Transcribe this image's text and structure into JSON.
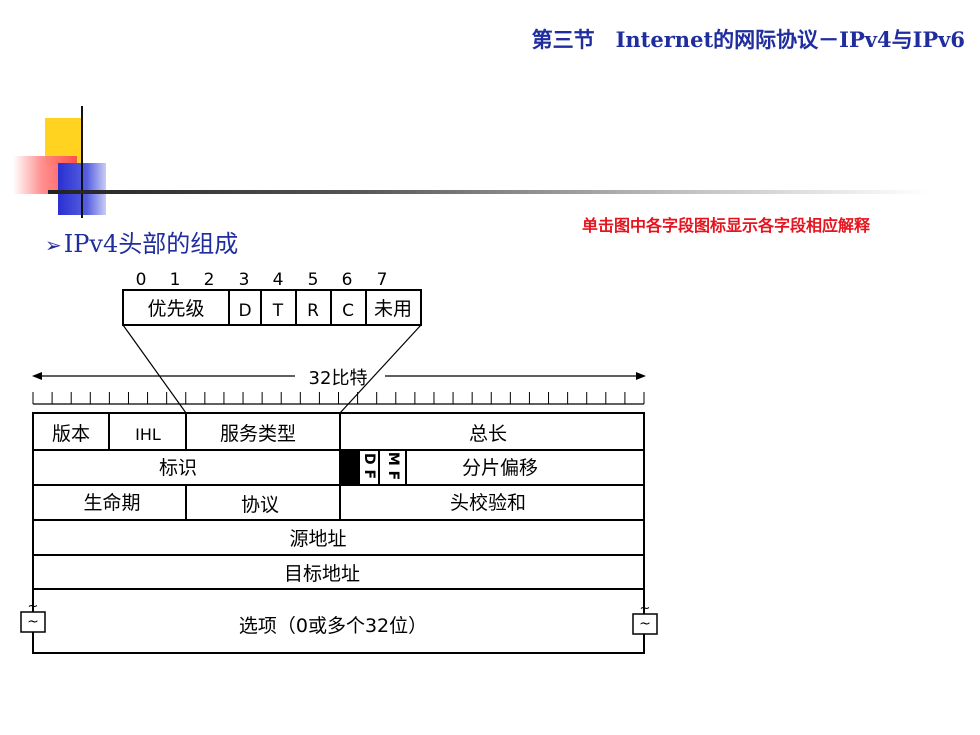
{
  "header": {
    "title": "第三节　Internet的网际协议－IPv4与IPv6"
  },
  "hint": {
    "text": "单击图中各字段图标显示各字段相应解释"
  },
  "section": {
    "bullet": "➢",
    "heading": "IPv4头部的组成"
  },
  "tos_detail": {
    "bit_labels": [
      "0",
      "1",
      "2",
      "3",
      "4",
      "5",
      "6",
      "7"
    ],
    "priority": "优先级",
    "d": "D",
    "t": "T",
    "r": "R",
    "c": "C",
    "unused": "未用"
  },
  "ruler": {
    "label": "32比特"
  },
  "header_fields": {
    "version": "版本",
    "ihl": "IHL",
    "tos": "服务类型",
    "total_length": "总长",
    "identification": "标识",
    "df": "D F",
    "mf": "M F",
    "fragment_offset": "分片偏移",
    "ttl": "生命期",
    "protocol": "协议",
    "header_checksum": "头校验和",
    "source_address": "源地址",
    "dest_address": "目标地址",
    "options": "选项（0或多个32位）",
    "tilde": "~"
  }
}
